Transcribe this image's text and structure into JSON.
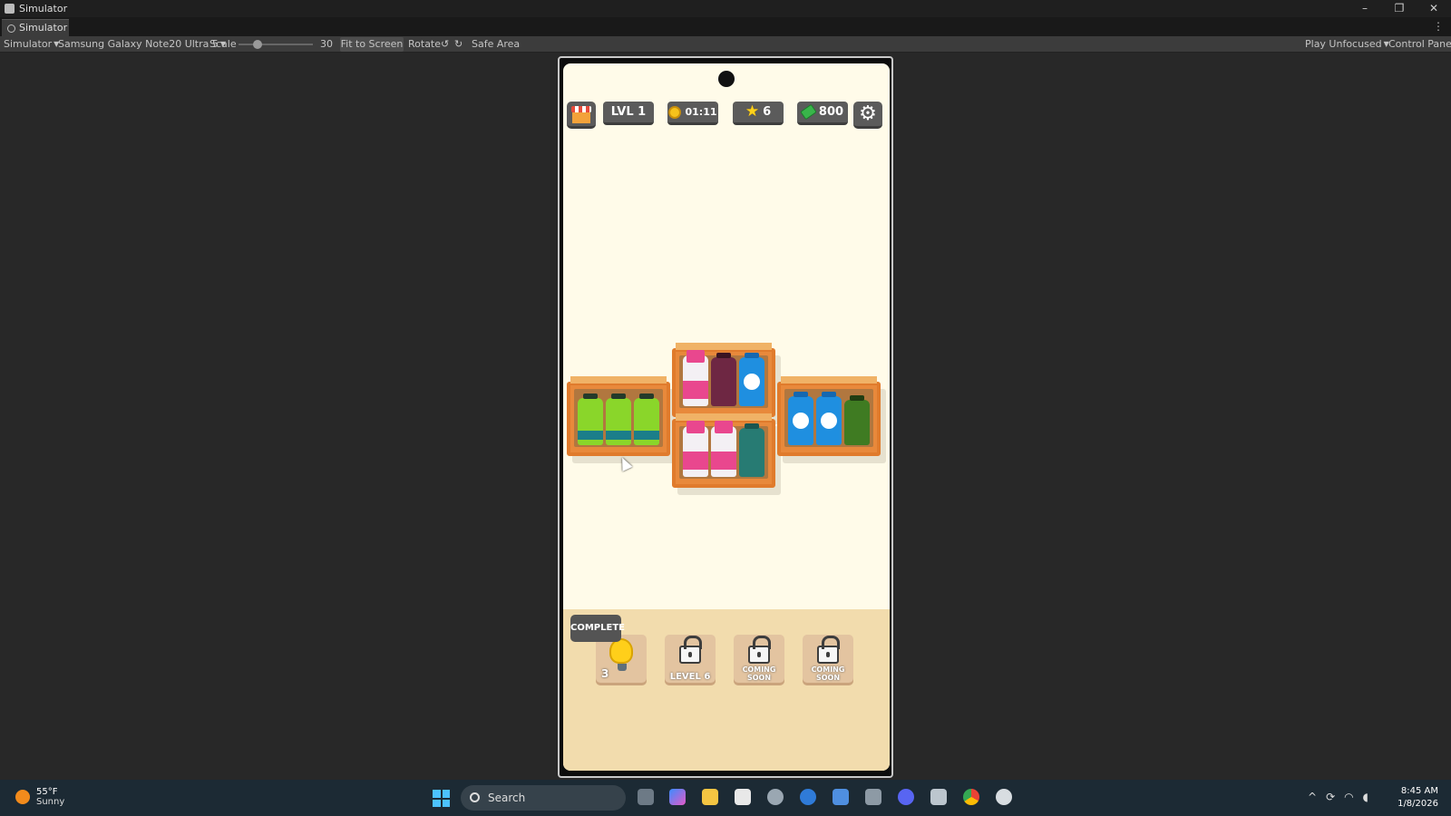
{
  "window": {
    "title": "Simulator",
    "tab": "Simulator"
  },
  "toolbar": {
    "simulator_menu": "Simulator",
    "device": "Samsung Galaxy Note20 Ultra 5",
    "scale_label": "Scale",
    "scale_value": "30",
    "fit_to_screen": "Fit to Screen",
    "rotate": "Rotate",
    "safe_area": "Safe Area",
    "play_mode": "Play Unfocused",
    "control_panel": "Control Panel"
  },
  "hud": {
    "level": "LVL 1",
    "timer": "01:11",
    "stars": "6",
    "cash": "800"
  },
  "boosters": {
    "complete_label": "COMPLETE",
    "hint_count": "3",
    "locked_1": "LEVEL 6",
    "locked_2": "COMING SOON",
    "locked_3": "COMING SOON"
  },
  "taskbar": {
    "temperature": "55°F",
    "condition": "Sunny",
    "search_placeholder": "Search",
    "time": "8:45 AM",
    "date": "1/8/2026"
  },
  "colors": {
    "background": "#fffbe9",
    "shelf": "#e8893b",
    "hud_pill": "#5b5b5b",
    "bottom_panel": "#f2dcad"
  }
}
